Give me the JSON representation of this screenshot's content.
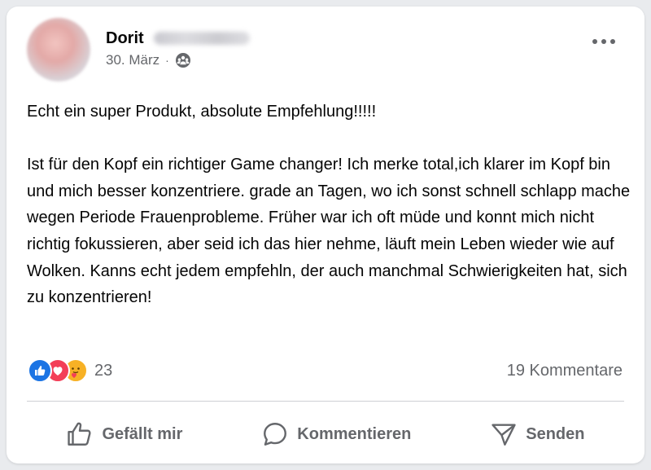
{
  "post": {
    "author_first_name": "Dorit",
    "date": "30. März",
    "separator": "·",
    "audience_icon": "friends-group-icon",
    "more_icon": "more-horizontal-icon",
    "text": "Echt ein super Produkt, absolute Empfehlung!!!!!\n\nIst für den Kopf ein richtiger Game changer! Ich merke total,ich klarer im Kopf bin und mich besser konzentriere. grade an Tagen, wo ich sonst schnell schlapp mache wegen Periode Frauenprobleme. Früher war ich oft müde und konnt mich nicht richtig fokussieren, aber seid ich das hier nehme, läuft mein Leben wieder wie auf Wolken. Kanns echt jedem empfehln, der auch manchmal Schwierigkeiten hat, sich zu konzentrieren!"
  },
  "reactions": {
    "types": [
      "like",
      "love",
      "care"
    ],
    "count": "23",
    "comments": "19 Kommentare"
  },
  "actions": {
    "like": "Gefällt mir",
    "comment": "Kommentieren",
    "share": "Senden"
  },
  "colors": {
    "like_blue": "#1b74e4",
    "love_red": "#f33e58",
    "care_yellow": "#f7b125",
    "secondary_text": "#65676b"
  }
}
